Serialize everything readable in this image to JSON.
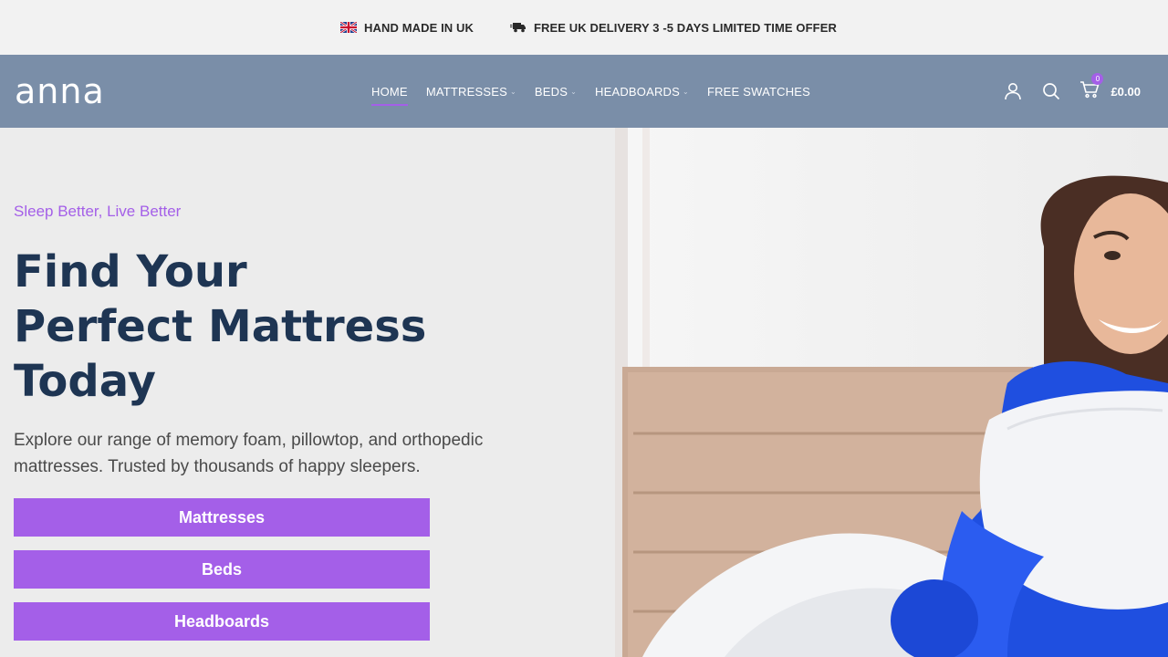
{
  "topbar": {
    "items": [
      {
        "icon": "uk-flag-icon",
        "label": "HAND MADE IN UK"
      },
      {
        "icon": "delivery-truck-icon",
        "label": "FREE UK DELIVERY 3 -5 DAYS LIMITED TIME OFFER"
      }
    ]
  },
  "header": {
    "logo": "anna",
    "nav": [
      {
        "label": "HOME",
        "active": true,
        "dropdown": false
      },
      {
        "label": "MATTRESSES",
        "active": false,
        "dropdown": true
      },
      {
        "label": "BEDS",
        "active": false,
        "dropdown": true
      },
      {
        "label": "HEADBOARDS",
        "active": false,
        "dropdown": true
      },
      {
        "label": "FREE SWATCHES",
        "active": false,
        "dropdown": false
      }
    ],
    "cart": {
      "count": "0",
      "total": "£0.00"
    },
    "icons": [
      "user-icon",
      "search-icon",
      "cart-icon"
    ]
  },
  "hero": {
    "tagline": "Sleep Better, Live Better",
    "headline": [
      "Find Your",
      "Perfect Mattress",
      "Today"
    ],
    "description": "Explore our range of memory foam, pillowtop, and orthopedic mattresses. Trusted by thousands of happy sleepers.",
    "buttons": [
      "Mattresses",
      "Beds",
      "Headboards"
    ]
  },
  "colors": {
    "accent": "#a45fe8",
    "header_bg": "#7a8ea8",
    "headline": "#1e3553",
    "topbar_bg": "#f2f2f2"
  }
}
